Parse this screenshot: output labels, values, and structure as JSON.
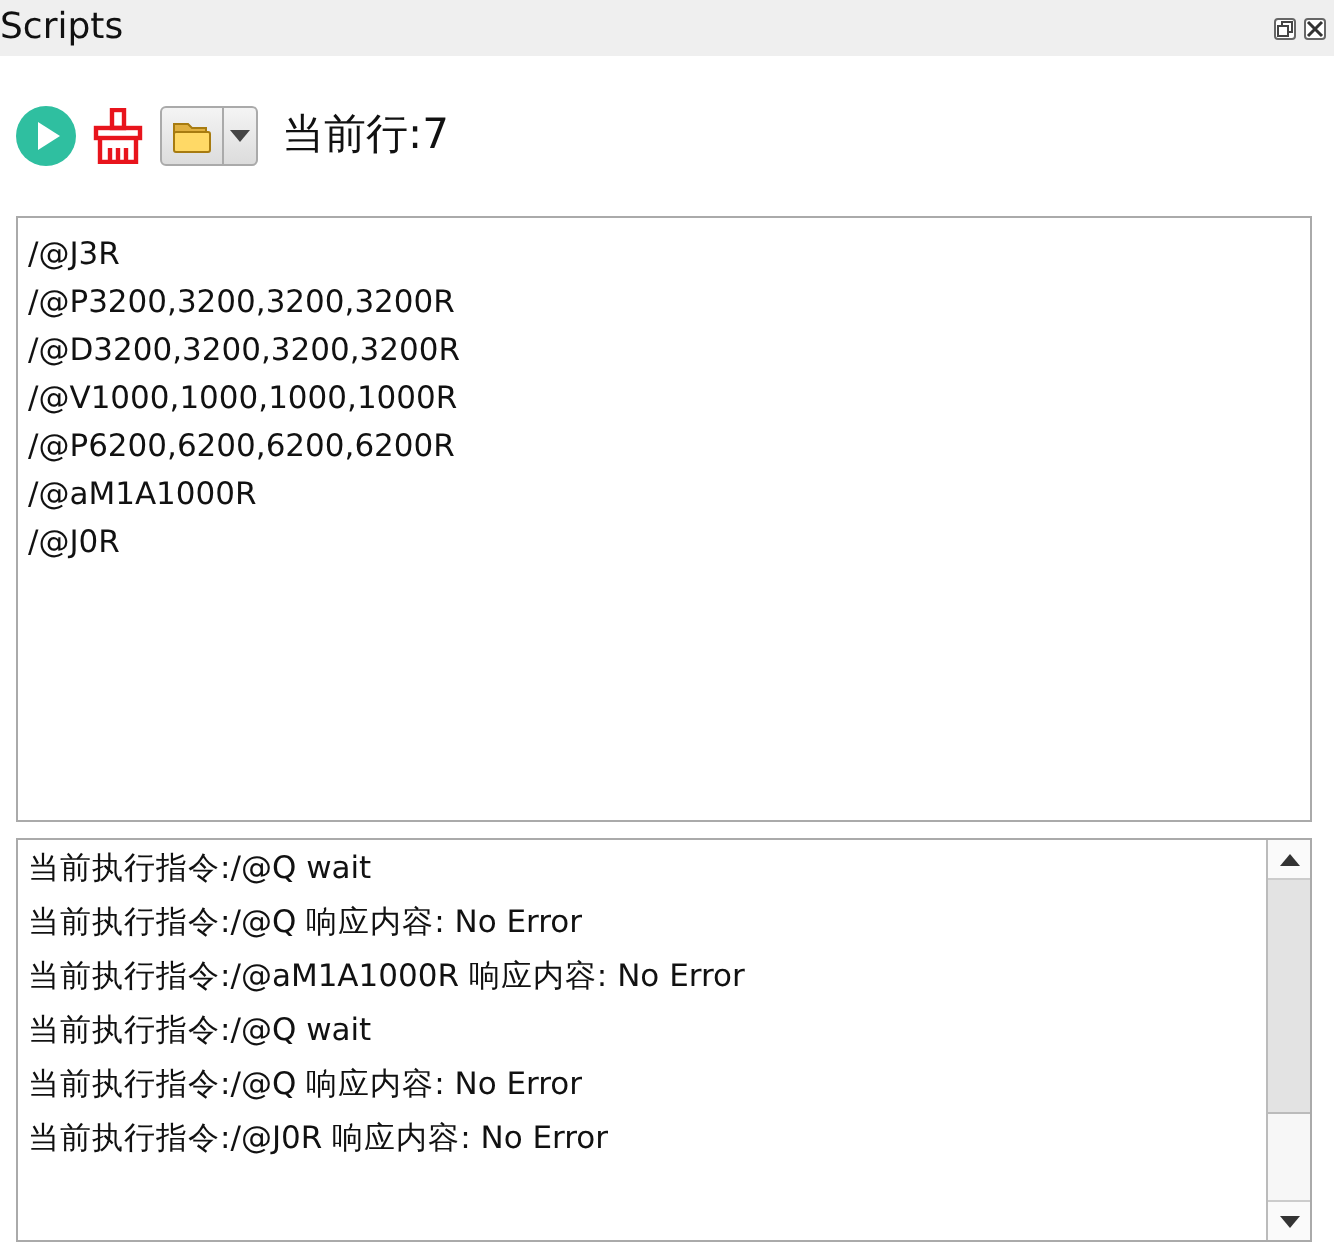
{
  "window": {
    "title": "Scripts"
  },
  "toolbar": {
    "current_line_label": "当前行:7"
  },
  "script_lines": [
    "/@J3R",
    "/@P3200,3200,3200,3200R",
    "/@D3200,3200,3200,3200R",
    "/@V1000,1000,1000,1000R",
    "/@P6200,6200,6200,6200R",
    "/@aM1A1000R",
    "/@J0R"
  ],
  "log_lines": [
    "当前执行指令:/@Q wait",
    "当前执行指令:/@Q 响应内容: No Error",
    "当前执行指令:/@aM1A1000R 响应内容: No Error",
    "当前执行指令:/@Q wait",
    "当前执行指令:/@Q 响应内容: No Error",
    "当前执行指令:/@J0R 响应内容: No Error"
  ]
}
